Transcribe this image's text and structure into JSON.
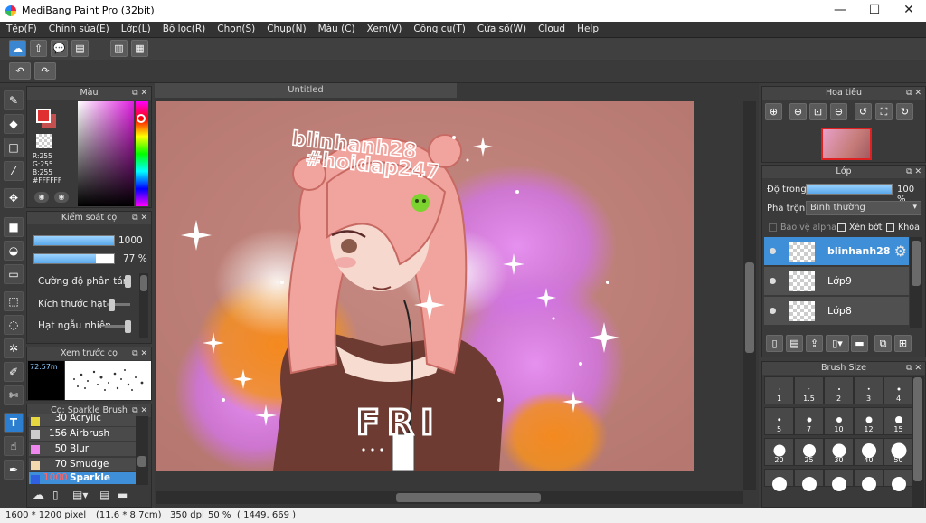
{
  "window": {
    "title": "MediBang Paint Pro (32bit)",
    "minimize": "—",
    "maximize": "☐",
    "close": "✕"
  },
  "menu": [
    "Tệp(F)",
    "Chỉnh sửa(E)",
    "Lớp(L)",
    "Bộ lọc(R)",
    "Chọn(S)",
    "Chụp(N)",
    "Màu (C)",
    "Xem(V)",
    "Công cụ(T)",
    "Cửa số(W)",
    "Cloud",
    "Help"
  ],
  "color_panel": {
    "title": "Màu",
    "r": "R:255",
    "g": "G:255",
    "b": "B:255",
    "hex": "#FFFFFF",
    "fg_color": "#e03030",
    "bg_color": "#ffffff"
  },
  "brush_control": {
    "title": "Kiểm soát cọ",
    "size_value": "1000",
    "opacity_value": "77 %",
    "size_fraction": 1.0,
    "opacity_fraction": 0.77,
    "row1": "Cường độ phân tán",
    "row2": "Kích thước hạt",
    "row3": "Hạt ngẫu nhiên"
  },
  "brush_preview": {
    "title": "Xem trước cọ",
    "size": "72.57m"
  },
  "brush_list": {
    "title": "Cọ: Sparkle Brush",
    "items": [
      {
        "size": "30",
        "name": "Acrylic",
        "color": "#e8d840"
      },
      {
        "size": "156",
        "name": "Airbrush",
        "color": "#cccccc"
      },
      {
        "size": "50",
        "name": "Blur",
        "color": "#ee88ee"
      },
      {
        "size": "70",
        "name": "Smudge",
        "color": "#f3d9b0"
      },
      {
        "size": "1000",
        "name": "Sparkle Brush",
        "color": "#3060e0"
      }
    ]
  },
  "canvas": {
    "tab": "Untitled",
    "text_name": "blinhanh28",
    "text_tag": "#hoidap247",
    "shirt_text": "FRI"
  },
  "navigator": {
    "title": "Hoa tiêu"
  },
  "layers": {
    "title": "Lớp",
    "opacity_label": "Độ trong",
    "opacity_value": "100 %",
    "opacity_fraction": 1.0,
    "blend_label": "Pha trộn",
    "blend_value": "Bình thường",
    "protect_alpha": "Bảo vệ alpha",
    "clipping": "Xén bớt",
    "lock": "Khóa",
    "items": [
      {
        "name": "blinhanh28",
        "selected": true
      },
      {
        "name": "Lớp9",
        "selected": false
      },
      {
        "name": "Lớp8",
        "selected": false
      }
    ]
  },
  "brush_size": {
    "title": "Brush Size",
    "sizes": [
      "1",
      "1.5",
      "2",
      "3",
      "4",
      "5",
      "7",
      "10",
      "12",
      "15",
      "20",
      "25",
      "30",
      "40",
      "50",
      "",
      "",
      "",
      "",
      ""
    ]
  },
  "status": {
    "dims": "1600 * 1200 pixel",
    "cm": "(11.6 * 8.7cm)",
    "dpi": "350 dpi",
    "zoom": "50 %",
    "coords": "( 1449, 669 )"
  }
}
